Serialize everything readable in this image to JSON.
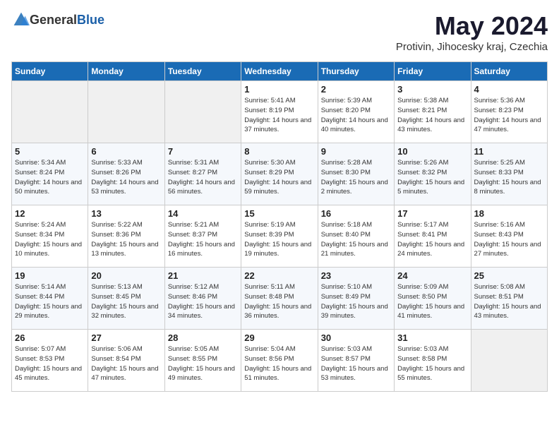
{
  "header": {
    "logo_general": "General",
    "logo_blue": "Blue",
    "title": "May 2024",
    "subtitle": "Protivin, Jihocesky kraj, Czechia"
  },
  "days_of_week": [
    "Sunday",
    "Monday",
    "Tuesday",
    "Wednesday",
    "Thursday",
    "Friday",
    "Saturday"
  ],
  "weeks": [
    {
      "days": [
        {
          "date": "",
          "info": ""
        },
        {
          "date": "",
          "info": ""
        },
        {
          "date": "",
          "info": ""
        },
        {
          "date": "1",
          "info": "Sunrise: 5:41 AM\nSunset: 8:19 PM\nDaylight: 14 hours\nand 37 minutes."
        },
        {
          "date": "2",
          "info": "Sunrise: 5:39 AM\nSunset: 8:20 PM\nDaylight: 14 hours\nand 40 minutes."
        },
        {
          "date": "3",
          "info": "Sunrise: 5:38 AM\nSunset: 8:21 PM\nDaylight: 14 hours\nand 43 minutes."
        },
        {
          "date": "4",
          "info": "Sunrise: 5:36 AM\nSunset: 8:23 PM\nDaylight: 14 hours\nand 47 minutes."
        }
      ]
    },
    {
      "days": [
        {
          "date": "5",
          "info": "Sunrise: 5:34 AM\nSunset: 8:24 PM\nDaylight: 14 hours\nand 50 minutes."
        },
        {
          "date": "6",
          "info": "Sunrise: 5:33 AM\nSunset: 8:26 PM\nDaylight: 14 hours\nand 53 minutes."
        },
        {
          "date": "7",
          "info": "Sunrise: 5:31 AM\nSunset: 8:27 PM\nDaylight: 14 hours\nand 56 minutes."
        },
        {
          "date": "8",
          "info": "Sunrise: 5:30 AM\nSunset: 8:29 PM\nDaylight: 14 hours\nand 59 minutes."
        },
        {
          "date": "9",
          "info": "Sunrise: 5:28 AM\nSunset: 8:30 PM\nDaylight: 15 hours\nand 2 minutes."
        },
        {
          "date": "10",
          "info": "Sunrise: 5:26 AM\nSunset: 8:32 PM\nDaylight: 15 hours\nand 5 minutes."
        },
        {
          "date": "11",
          "info": "Sunrise: 5:25 AM\nSunset: 8:33 PM\nDaylight: 15 hours\nand 8 minutes."
        }
      ]
    },
    {
      "days": [
        {
          "date": "12",
          "info": "Sunrise: 5:24 AM\nSunset: 8:34 PM\nDaylight: 15 hours\nand 10 minutes."
        },
        {
          "date": "13",
          "info": "Sunrise: 5:22 AM\nSunset: 8:36 PM\nDaylight: 15 hours\nand 13 minutes."
        },
        {
          "date": "14",
          "info": "Sunrise: 5:21 AM\nSunset: 8:37 PM\nDaylight: 15 hours\nand 16 minutes."
        },
        {
          "date": "15",
          "info": "Sunrise: 5:19 AM\nSunset: 8:39 PM\nDaylight: 15 hours\nand 19 minutes."
        },
        {
          "date": "16",
          "info": "Sunrise: 5:18 AM\nSunset: 8:40 PM\nDaylight: 15 hours\nand 21 minutes."
        },
        {
          "date": "17",
          "info": "Sunrise: 5:17 AM\nSunset: 8:41 PM\nDaylight: 15 hours\nand 24 minutes."
        },
        {
          "date": "18",
          "info": "Sunrise: 5:16 AM\nSunset: 8:43 PM\nDaylight: 15 hours\nand 27 minutes."
        }
      ]
    },
    {
      "days": [
        {
          "date": "19",
          "info": "Sunrise: 5:14 AM\nSunset: 8:44 PM\nDaylight: 15 hours\nand 29 minutes."
        },
        {
          "date": "20",
          "info": "Sunrise: 5:13 AM\nSunset: 8:45 PM\nDaylight: 15 hours\nand 32 minutes."
        },
        {
          "date": "21",
          "info": "Sunrise: 5:12 AM\nSunset: 8:46 PM\nDaylight: 15 hours\nand 34 minutes."
        },
        {
          "date": "22",
          "info": "Sunrise: 5:11 AM\nSunset: 8:48 PM\nDaylight: 15 hours\nand 36 minutes."
        },
        {
          "date": "23",
          "info": "Sunrise: 5:10 AM\nSunset: 8:49 PM\nDaylight: 15 hours\nand 39 minutes."
        },
        {
          "date": "24",
          "info": "Sunrise: 5:09 AM\nSunset: 8:50 PM\nDaylight: 15 hours\nand 41 minutes."
        },
        {
          "date": "25",
          "info": "Sunrise: 5:08 AM\nSunset: 8:51 PM\nDaylight: 15 hours\nand 43 minutes."
        }
      ]
    },
    {
      "days": [
        {
          "date": "26",
          "info": "Sunrise: 5:07 AM\nSunset: 8:53 PM\nDaylight: 15 hours\nand 45 minutes."
        },
        {
          "date": "27",
          "info": "Sunrise: 5:06 AM\nSunset: 8:54 PM\nDaylight: 15 hours\nand 47 minutes."
        },
        {
          "date": "28",
          "info": "Sunrise: 5:05 AM\nSunset: 8:55 PM\nDaylight: 15 hours\nand 49 minutes."
        },
        {
          "date": "29",
          "info": "Sunrise: 5:04 AM\nSunset: 8:56 PM\nDaylight: 15 hours\nand 51 minutes."
        },
        {
          "date": "30",
          "info": "Sunrise: 5:03 AM\nSunset: 8:57 PM\nDaylight: 15 hours\nand 53 minutes."
        },
        {
          "date": "31",
          "info": "Sunrise: 5:03 AM\nSunset: 8:58 PM\nDaylight: 15 hours\nand 55 minutes."
        },
        {
          "date": "",
          "info": ""
        }
      ]
    }
  ]
}
